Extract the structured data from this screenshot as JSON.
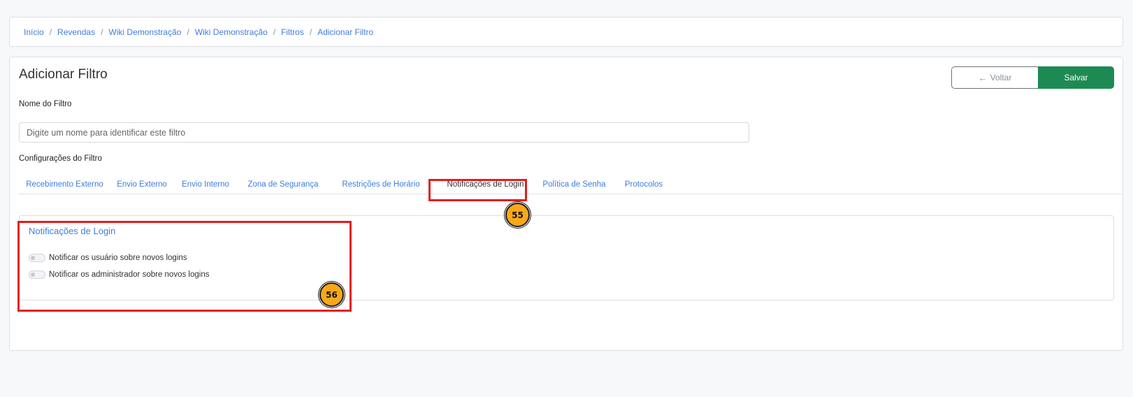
{
  "breadcrumb": {
    "items": [
      "Início",
      "Revendas",
      "Wiki Demonstração",
      "Wiki Demonstração",
      "Filtros",
      "Adicionar Filtro"
    ],
    "separator": "/"
  },
  "page": {
    "title": "Adicionar Filtro",
    "back_label": "Voltar",
    "save_label": "Salvar"
  },
  "form": {
    "name_label": "Nome do Filtro",
    "name_value": "",
    "name_placeholder": "Digite um nome para identificar este filtro",
    "config_label": "Configurações do Filtro"
  },
  "tabs": [
    {
      "label": "Recebimento Externo"
    },
    {
      "label": "Envio Externo"
    },
    {
      "label": "Envio Interno"
    },
    {
      "label": "Zona de Segurança"
    },
    {
      "label": "Restrições de Horário"
    },
    {
      "label": "Notificações de Login",
      "active": true
    },
    {
      "label": "Política de Senha"
    },
    {
      "label": "Protocolos"
    }
  ],
  "section": {
    "title": "Notificações de Login",
    "toggles": [
      {
        "label": "Notificar os usuário sobre novos logins",
        "enabled": false
      },
      {
        "label": "Notificar os administrador sobre novos logins",
        "enabled": false
      }
    ]
  },
  "annotations": {
    "badge_tab": "55",
    "badge_panel": "56"
  },
  "colors": {
    "link": "#3d7de0",
    "save_button": "#1e8a53",
    "highlight": "#e51c1c",
    "badge": "#f8a817"
  }
}
